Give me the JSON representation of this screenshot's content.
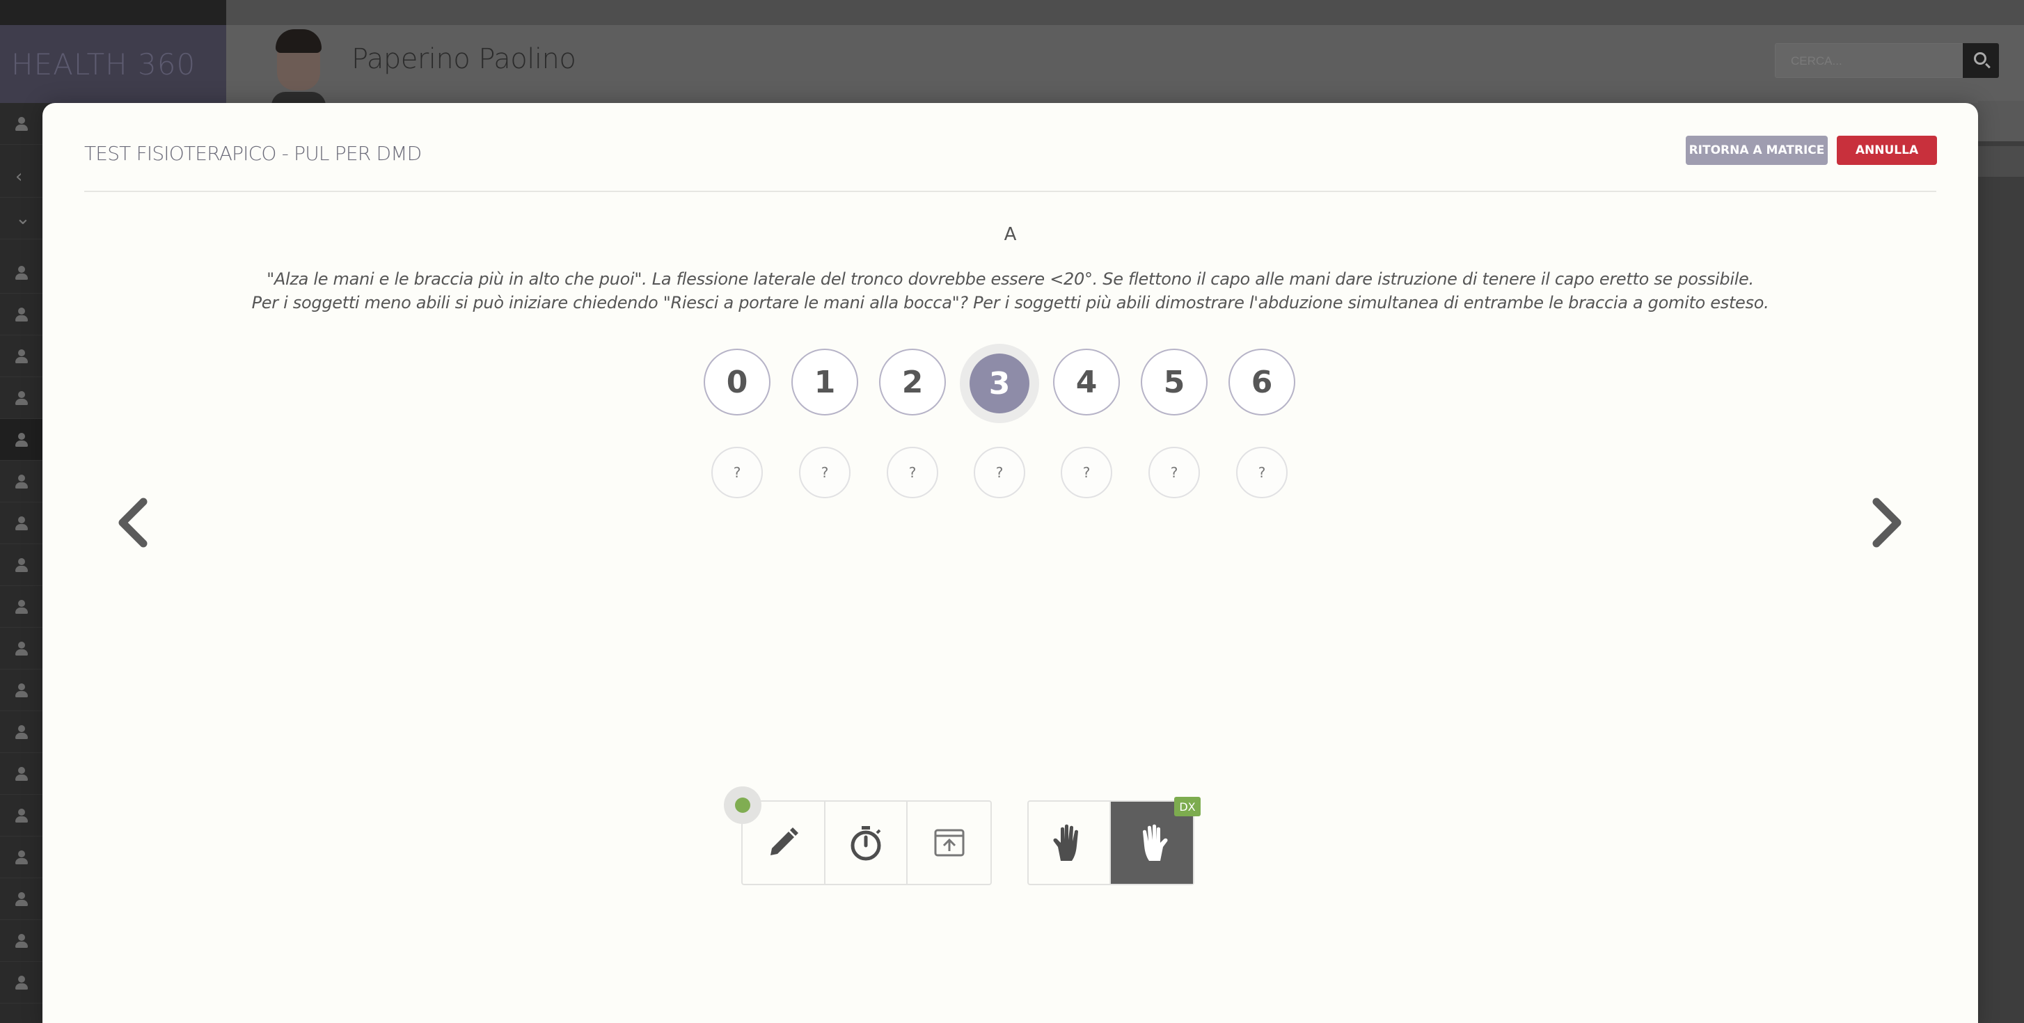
{
  "app": {
    "logo": "HEALTH 360",
    "patient_name": "Paperino Paolino",
    "search_placeholder": "CERCA..."
  },
  "modal": {
    "title": "TEST FISIOTERAPICO - PUL PER DMD",
    "back_button": "RITORNA A MATRICE",
    "cancel_button": "ANNULLA",
    "item_letter": "A",
    "instruction": "\"Alza le mani e le braccia più in alto che puoi\". La flessione laterale del tronco dovrebbe essere <20°. Se flettono il capo alle mani dare istruzione di tenere il capo eretto se possibile. Per i soggetti meno abili si può iniziare chiedendo \"Riesci a portare le mani alla bocca\"? Per i soggetti più abili dimostrare l'abduzione simultanea di entrambe le braccia a gomito esteso.",
    "scores": [
      "0",
      "1",
      "2",
      "3",
      "4",
      "5",
      "6"
    ],
    "selected_score": "3",
    "help_label": "?",
    "side_badge": "DX",
    "status_color": "#80ad52",
    "accent_color": "#8e8ca8",
    "cancel_color": "#c8303c"
  },
  "icons": {
    "prev": "chevron-left-icon",
    "next": "chevron-right-icon",
    "tools": [
      "pencil-icon",
      "stopwatch-icon",
      "upload-icon",
      "left-hand-icon",
      "right-hand-icon"
    ]
  }
}
